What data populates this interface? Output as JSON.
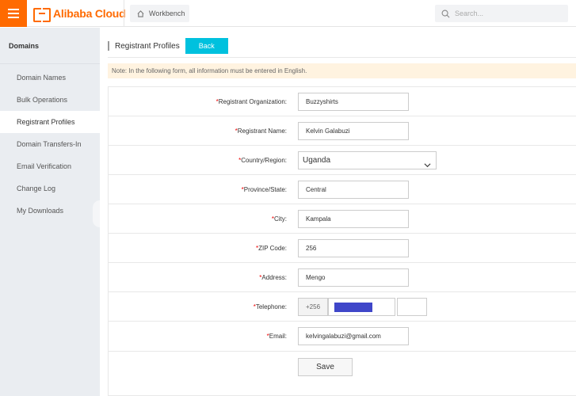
{
  "header": {
    "logo_text": "Alibaba Cloud",
    "workbench_label": "Workbench",
    "search_placeholder": "Search..."
  },
  "sidebar": {
    "title": "Domains",
    "items": [
      {
        "label": "Domain Names"
      },
      {
        "label": "Bulk Operations"
      },
      {
        "label": "Registrant Profiles"
      },
      {
        "label": "Domain Transfers-In"
      },
      {
        "label": "Email Verification"
      },
      {
        "label": "Change Log"
      },
      {
        "label": "My Downloads"
      }
    ],
    "active_index": 2
  },
  "main": {
    "page_title": "Registrant Profiles",
    "back_label": "Back",
    "note": "Note: In the following form, all information must be entered in English.",
    "required_mark": "*",
    "fields": {
      "organization": {
        "label": "Registrant Organization:",
        "value": "Buzzyshirts"
      },
      "name": {
        "label": "Registrant Name:",
        "value": "Kelvin Galabuzi"
      },
      "country": {
        "label": "Country/Region:",
        "value": "Uganda"
      },
      "province": {
        "label": "Province/State:",
        "value": "Central"
      },
      "city": {
        "label": "City:",
        "value": "Kampala"
      },
      "zip": {
        "label": "ZIP Code:",
        "value": "256"
      },
      "address": {
        "label": "Address:",
        "value": "Mengo"
      },
      "telephone": {
        "label": "Telephone:",
        "code": "+256",
        "number": "",
        "extension": ""
      },
      "email": {
        "label": "Email:",
        "value": "kelvingalabuzi@gmail.com"
      }
    },
    "save_label": "Save"
  },
  "colors": {
    "brand": "#ff6a00",
    "back_button": "#00c1de",
    "note_bg": "#fff3e0",
    "required": "#e00000",
    "redaction": "#3f46c9"
  }
}
